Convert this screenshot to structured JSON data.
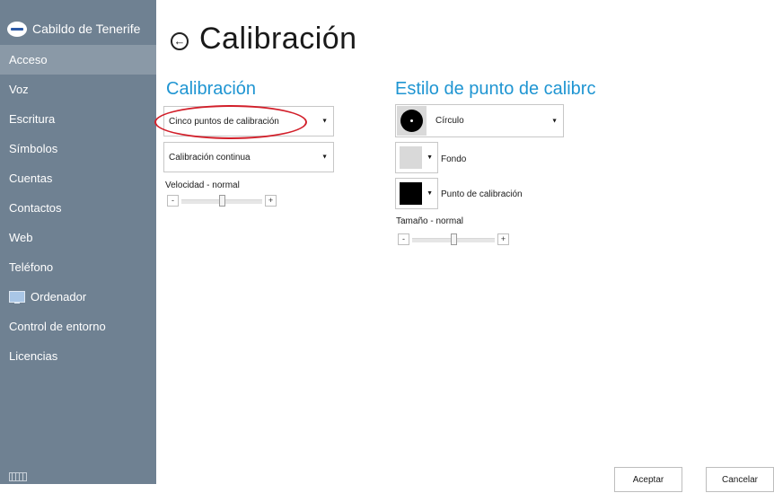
{
  "sidebar": {
    "brand_name": "Cabildo de Tenerife",
    "items": [
      {
        "label": "Acceso",
        "active": true
      },
      {
        "label": "Voz"
      },
      {
        "label": "Escritura"
      },
      {
        "label": "Símbolos"
      },
      {
        "label": "Cuentas"
      },
      {
        "label": "Contactos"
      },
      {
        "label": "Web"
      },
      {
        "label": "Teléfono"
      },
      {
        "label": "Ordenador",
        "icon": "computer-icon"
      },
      {
        "label": "Control de entorno"
      },
      {
        "label": "Licencias"
      }
    ],
    "bottom_icon": "keyboard-icon"
  },
  "header": {
    "back_icon": "back-arrow-circle-icon",
    "title": "Calibración"
  },
  "calibration": {
    "section_title": "Calibración",
    "points_dropdown": "Cinco puntos de calibración",
    "mode_dropdown": "Calibración continua",
    "speed_label": "Velocidad - normal",
    "minus": "-",
    "plus": "+",
    "speed_level": 0.5
  },
  "style": {
    "section_title": "Estilo de punto de calibrc",
    "shape_dropdown": "Círculo",
    "background_label": "Fondo",
    "background_color": "#d9d9d9",
    "point_label": "Punto de calibración",
    "point_color": "#000000",
    "size_label": "Tamaño - normal",
    "minus": "-",
    "plus": "+",
    "size_level": 0.5
  },
  "footer": {
    "accept": "Aceptar",
    "cancel": "Cancelar"
  },
  "colors": {
    "sidebar_bg": "#6f8192",
    "sidebar_active": "#8a99a7",
    "accent": "#1f95d2",
    "highlight": "#d21f2a"
  }
}
